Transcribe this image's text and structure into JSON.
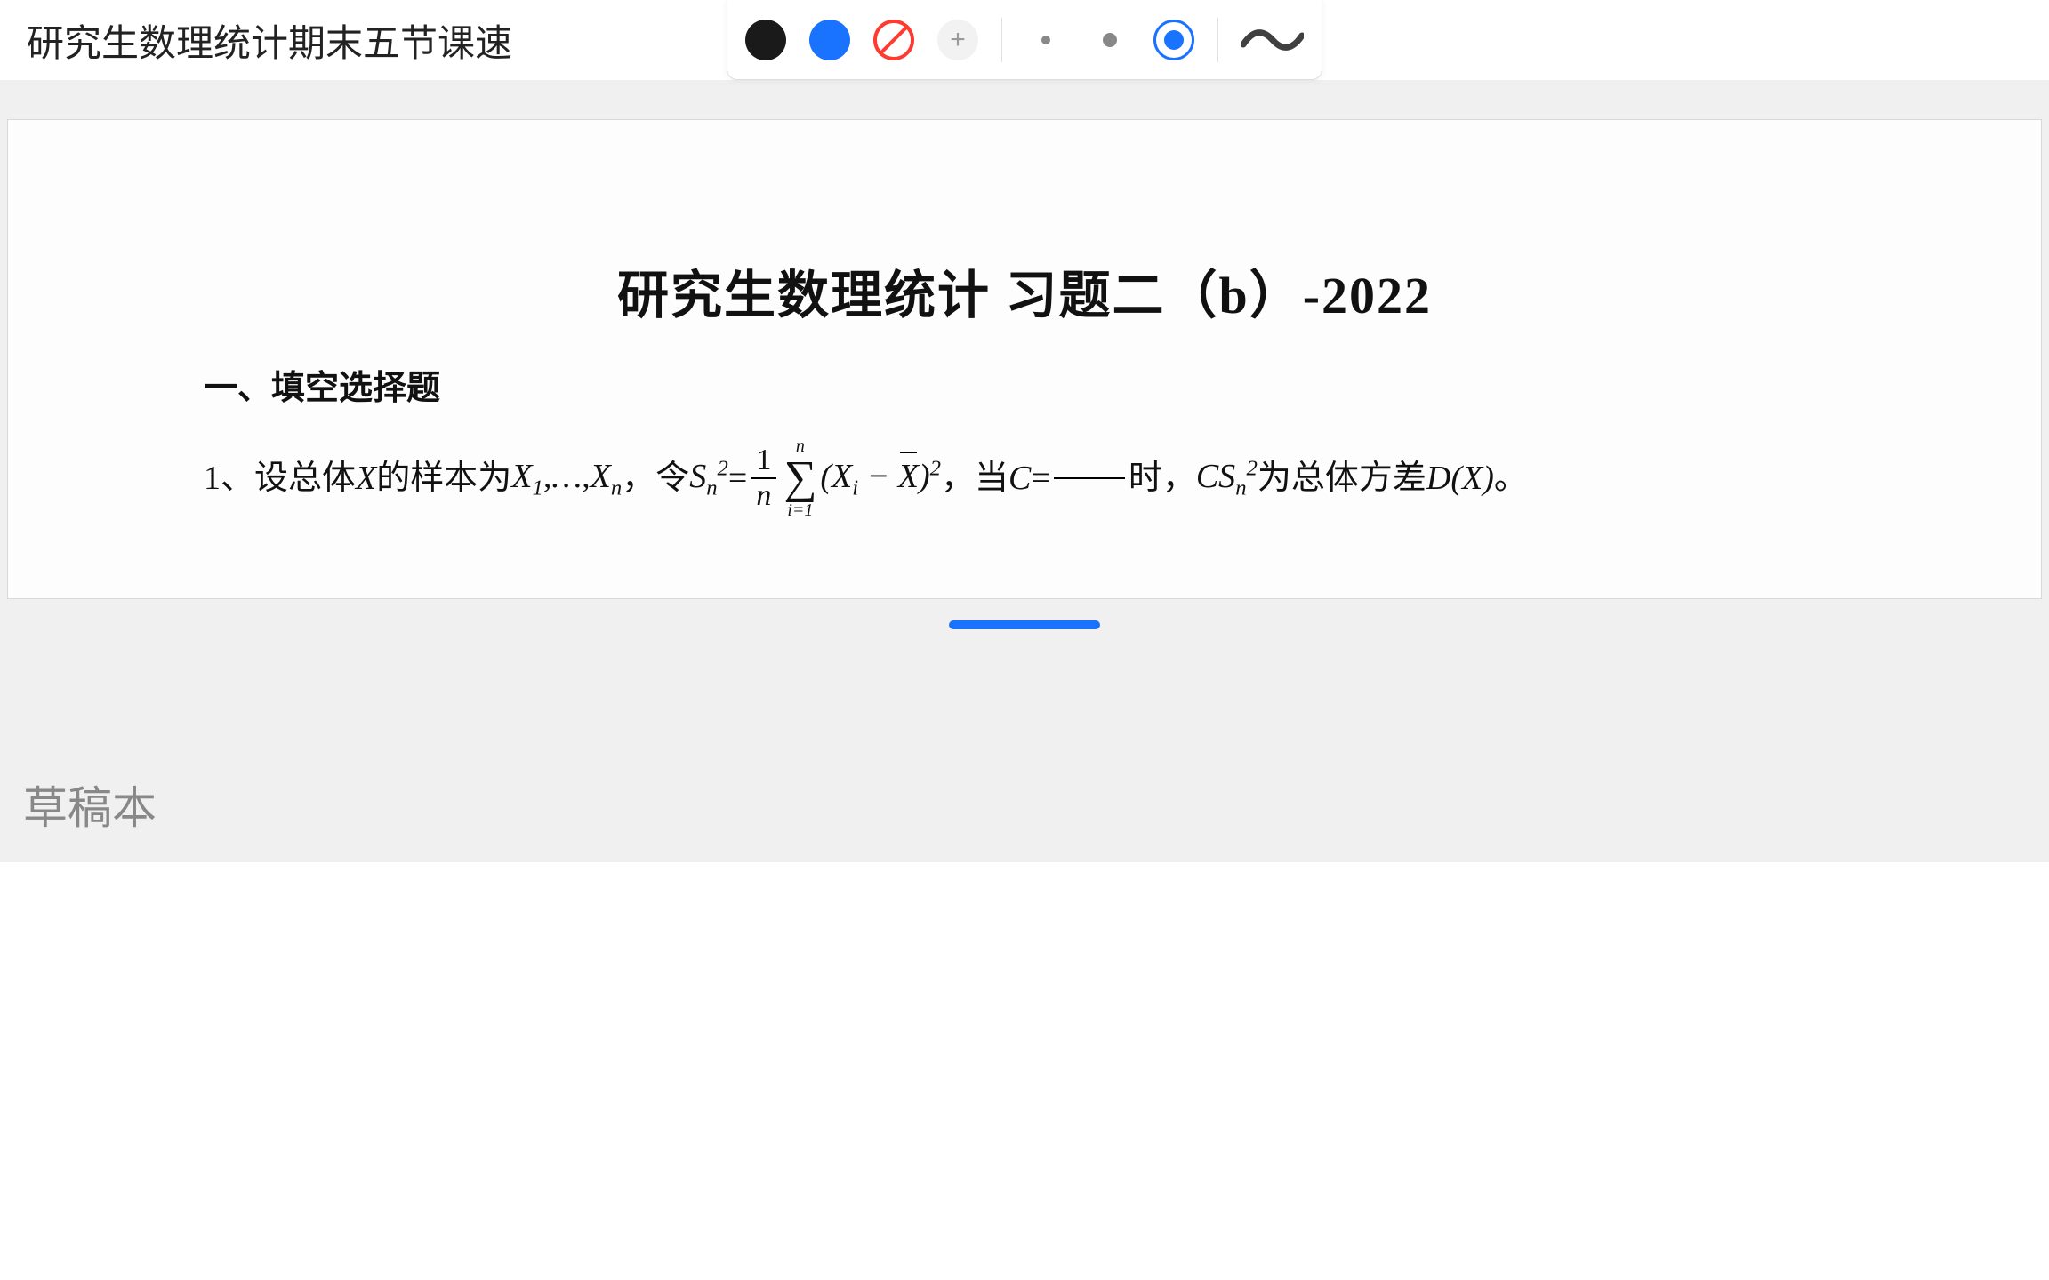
{
  "header": {
    "doc_title": "研究生数理统计期末五节课速"
  },
  "toolbar": {
    "colors": {
      "black": "#1a1a1a",
      "blue": "#1a73ff",
      "red": "#ff3b30"
    },
    "add_label": "+",
    "selected_size": "large"
  },
  "document": {
    "title": "研究生数理统计 习题二（b）-2022",
    "section_heading": "一、填空选择题",
    "question": {
      "number": "1、",
      "text_before_sample": "设总体 ",
      "var_X": "X",
      "text_sample": " 的样本为 ",
      "sample_seq": "X₁,…,Xₙ",
      "text_let": " ，令 ",
      "stat_symbol": "Sₙ²",
      "equals": " = ",
      "frac_num": "1",
      "frac_den": "n",
      "sigma_top": "n",
      "sigma_sym": "∑",
      "sigma_bot": "i=1",
      "summand": "(Xᵢ − X̄)²",
      "text_when": " ，当 ",
      "var_C": "C",
      "text_eq": " = ",
      "text_then": " 时，",
      "result": "CSₙ²",
      "text_is": " 为总体方差 ",
      "dx": "D(X)",
      "period": "。"
    }
  },
  "scratch": {
    "title": "草稿本"
  }
}
